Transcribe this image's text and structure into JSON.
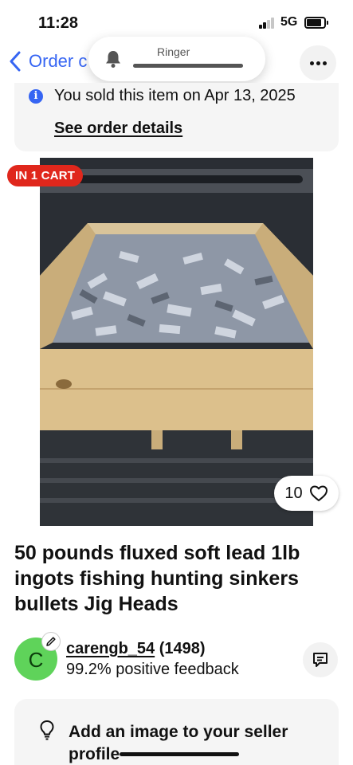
{
  "status_bar": {
    "time": "11:28",
    "network": "5G"
  },
  "nav": {
    "back_label": "Order c",
    "more_icon": "more-horizontal-icon"
  },
  "ringer": {
    "label": "Ringer",
    "level": 1.0
  },
  "sold_banner": {
    "text": "You sold this item on Apr 13, 2025",
    "link": "See order details",
    "icon": "info-icon",
    "accent": "#3665f3"
  },
  "listing": {
    "cart_badge": "IN 1 CART",
    "cart_badge_color": "#e0271c",
    "watch_count": "10",
    "title": "50 pounds  fluxed soft lead 1lb ingots fishing hunting sinkers bullets Jig Heads"
  },
  "seller": {
    "avatar_letter": "C",
    "avatar_color": "#5fd35a",
    "username": "carengb_54",
    "rating_count": "(1498)",
    "feedback": "99.2% positive feedback"
  },
  "tip": {
    "text": "Add an image to your seller profile",
    "icon": "lightbulb-icon"
  }
}
